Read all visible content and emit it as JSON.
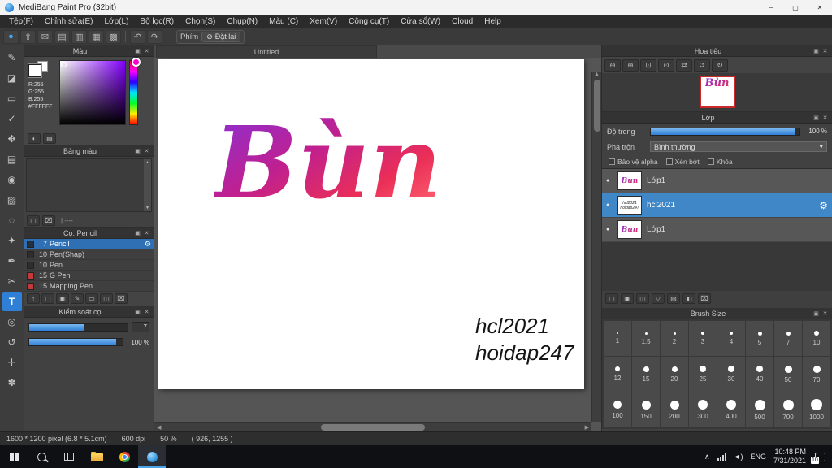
{
  "icons": {
    "minimize": "─",
    "maximize": "▢",
    "close": "✕",
    "popout": "▣",
    "panel_close": "✕",
    "gear": "⚙",
    "dot": "●",
    "dropdown": "▾",
    "slash": "⊘",
    "chevron_up": "∧",
    "speaker": "◄)",
    "scroll_up": "▲",
    "scroll_down": "▼",
    "left_arrow": "◀",
    "right_arrow": "▶"
  },
  "window": {
    "title": "MediBang Paint Pro (32bit)"
  },
  "menus": [
    "Tệp(F)",
    "Chỉnh sửa(E)",
    "Lớp(L)",
    "Bộ lọc(R)",
    "Chọn(S)",
    "Chụp(N)",
    "Màu (C)",
    "Xem(V)",
    "Công cụ(T)",
    "Cửa sổ(W)",
    "Cloud",
    "Help"
  ],
  "toolbar": {
    "icons": [
      {
        "name": "medibang-cloud-icon",
        "glyph": "●",
        "color": "#4aa3e8"
      },
      {
        "name": "upload-icon",
        "glyph": "⇧"
      },
      {
        "name": "comment-icon",
        "glyph": "✉"
      },
      {
        "name": "new-canvas-icon",
        "glyph": "▤"
      },
      {
        "name": "export-icon",
        "glyph": "▥"
      },
      {
        "name": "grid-icon",
        "glyph": "▦"
      },
      {
        "name": "material-icon",
        "glyph": "▩"
      },
      {
        "sep": true
      },
      {
        "name": "undo-icon",
        "glyph": "↶"
      },
      {
        "name": "redo-icon",
        "glyph": "↷"
      },
      {
        "sep": true
      }
    ],
    "phim_label": "Phím",
    "reset_label": "Đặt lại"
  },
  "tools": [
    {
      "name": "pen-tool",
      "glyph": "✎"
    },
    {
      "name": "eraser-tool",
      "glyph": "◪"
    },
    {
      "name": "marquee-tool",
      "glyph": "▭"
    },
    {
      "name": "select-pen-tool",
      "glyph": "✓"
    },
    {
      "name": "move-tool",
      "glyph": "✥"
    },
    {
      "name": "fill-tool",
      "glyph": "▤"
    },
    {
      "name": "bucket-tool",
      "glyph": "◉"
    },
    {
      "name": "gradient-tool",
      "glyph": "▨"
    },
    {
      "name": "lasso-select-tool",
      "glyph": "◌"
    },
    {
      "name": "magic-wand-tool",
      "glyph": "✦"
    },
    {
      "name": "control-pen-tool",
      "glyph": "✒"
    },
    {
      "name": "divide-tool",
      "glyph": "✂"
    },
    {
      "name": "text-tool",
      "glyph": "T",
      "active": true
    },
    {
      "name": "zoom-tool",
      "glyph": "◎"
    },
    {
      "name": "rotate-tool",
      "glyph": "↺"
    },
    {
      "name": "eyedropper-tool",
      "glyph": "✛"
    },
    {
      "name": "hand-tool",
      "glyph": "✽"
    }
  ],
  "color_panel": {
    "title": "Màu",
    "r": "R:255",
    "g": "G:255",
    "b": "B:255",
    "hex": "#FFFFFF",
    "buttons": [
      {
        "name": "color-wheel-button",
        "glyph": "◐"
      },
      {
        "name": "color-slider-button",
        "glyph": "▤"
      }
    ]
  },
  "palette_panel": {
    "title": "Bảng màu",
    "footer_icons": [
      {
        "name": "add-color-button",
        "glyph": "▢"
      },
      {
        "name": "delete-color-button",
        "glyph": "⌧"
      }
    ],
    "footer_text": "| ----"
  },
  "brush_panel": {
    "title": "Cọ: Pencil",
    "brushes": [
      {
        "size": "7",
        "name": "Pencil",
        "swatch": "#24313f",
        "selected": true
      },
      {
        "size": "10",
        "name": "Pen(Shap)",
        "swatch": "#2e2e2e"
      },
      {
        "size": "10",
        "name": "Pen",
        "swatch": "#2e2e2e"
      },
      {
        "size": "15",
        "name": "G Pen",
        "swatch": "#c43a3a"
      },
      {
        "size": "15",
        "name": "Mapping Pen",
        "swatch": "#c43a3a"
      }
    ],
    "footer_icons": [
      {
        "name": "brush-sort-button",
        "glyph": "↑"
      },
      {
        "name": "add-brush-button",
        "glyph": "▢"
      },
      {
        "name": "add-brush-folder-button",
        "glyph": "▣"
      },
      {
        "name": "edit-brush-button",
        "glyph": "✎"
      },
      {
        "name": "brush-preview-button",
        "glyph": "▭"
      },
      {
        "name": "duplicate-brush-button",
        "glyph": "◫"
      },
      {
        "name": "delete-brush-button",
        "glyph": "⌧"
      }
    ]
  },
  "brush_control_panel": {
    "title": "Kiểm soát cọ",
    "size_value": "7",
    "size_fill": "55%",
    "opacity_value": "100 %",
    "opacity_fill": "93%"
  },
  "canvas": {
    "tab": "Untitled",
    "artwork_text": "Bùn",
    "watermark_line1": "hcl2021",
    "watermark_line2": "hoidap247"
  },
  "navigator_panel": {
    "title": "Hoa tiêu",
    "icons": [
      {
        "name": "zoom-out-icon",
        "glyph": "⊖"
      },
      {
        "name": "zoom-in-icon",
        "glyph": "⊕"
      },
      {
        "name": "fit-window-icon",
        "glyph": "⊡"
      },
      {
        "name": "zoom-100-icon",
        "glyph": "⊙"
      },
      {
        "name": "flip-view-icon",
        "glyph": "⇄"
      },
      {
        "name": "rotate-left-icon",
        "glyph": "↺"
      },
      {
        "name": "rotate-right-icon",
        "glyph": "↻"
      }
    ]
  },
  "layers_panel": {
    "title": "Lớp",
    "opacity_label": "Độ trong",
    "opacity_value": "100 %",
    "blend_label": "Pha trộn",
    "blend_value": "Bình thường",
    "checkboxes": [
      "Bảo vệ alpha",
      "Xén bớt",
      "Khóa"
    ],
    "layers": [
      {
        "name": "Lớp1",
        "thumb": "art"
      },
      {
        "name": "hcl2021",
        "thumb": "text",
        "thumb_label": "hcl2021 hoidap247",
        "selected": true
      },
      {
        "name": "Lớp1",
        "thumb": "art"
      }
    ],
    "footer_icons": [
      {
        "name": "add-layer-button",
        "glyph": "▢"
      },
      {
        "name": "add-folder-button",
        "glyph": "▣"
      },
      {
        "name": "duplicate-layer-button",
        "glyph": "◫"
      },
      {
        "name": "merge-layer-button",
        "glyph": "▽"
      },
      {
        "name": "layer-effect-button",
        "glyph": "▨"
      },
      {
        "name": "layer-mask-button",
        "glyph": "◧"
      },
      {
        "name": "delete-layer-button",
        "glyph": "⌧"
      }
    ]
  },
  "brush_size_panel": {
    "title": "Brush Size",
    "sizes": [
      "1",
      "1.5",
      "2",
      "3",
      "4",
      "5",
      "7",
      "10",
      "12",
      "15",
      "20",
      "25",
      "30",
      "40",
      "50",
      "70",
      "100",
      "150",
      "200",
      "300",
      "400",
      "500",
      "700",
      "1000"
    ]
  },
  "status_bar": {
    "size_text": "1600 * 1200 pixel  (6.8 * 5.1cm)",
    "dpi_text": "600 dpi",
    "zoom_text": "50 %",
    "coords": "( 926, 1255 )"
  },
  "taskbar": {
    "language": "ENG",
    "time": "10:48 PM",
    "date": "7/31/2021",
    "notification_count": "10"
  }
}
